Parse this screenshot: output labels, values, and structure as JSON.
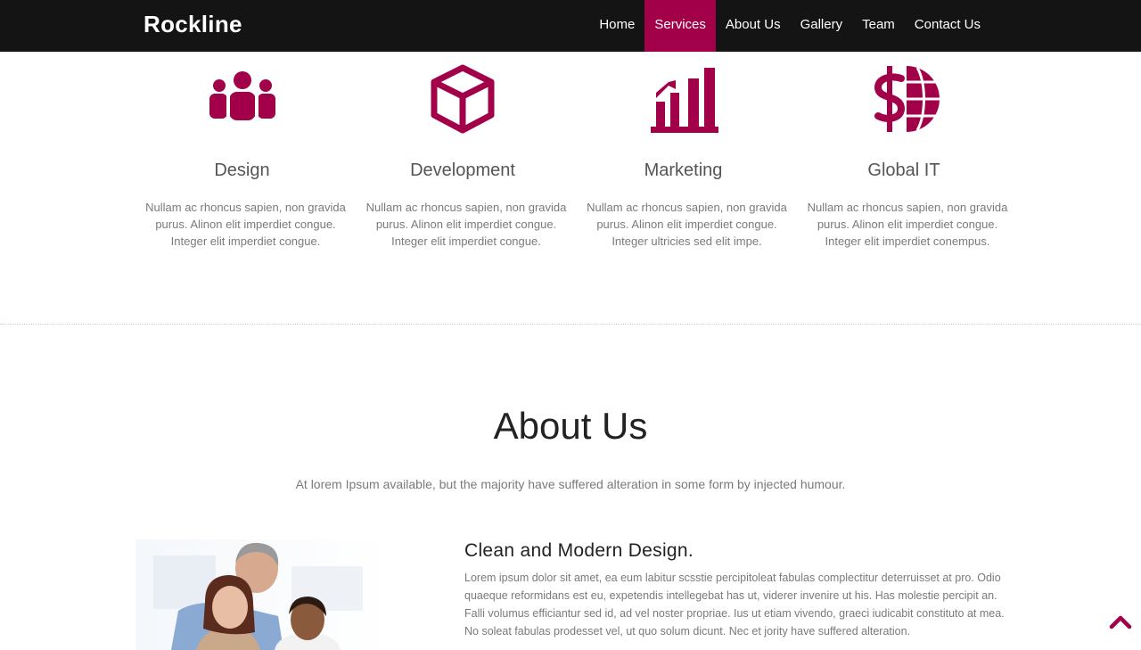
{
  "brand": "Rockline",
  "nav": {
    "items": [
      {
        "label": "Home"
      },
      {
        "label": "Services"
      },
      {
        "label": "About Us"
      },
      {
        "label": "Gallery"
      },
      {
        "label": "Team"
      },
      {
        "label": "Contact Us"
      }
    ],
    "active": "Services"
  },
  "services": [
    {
      "icon": "users-icon",
      "title": "Design",
      "desc": "Nullam ac rhoncus sapien, non gravida purus. Alinon elit imperdiet congue. Integer elit imperdiet congue."
    },
    {
      "icon": "cube-icon",
      "title": "Development",
      "desc": "Nullam ac rhoncus sapien, non gravida purus. Alinon elit imperdiet congue. Integer elit imperdiet congue."
    },
    {
      "icon": "bar-chart-icon",
      "title": "Marketing",
      "desc": "Nullam ac rhoncus sapien, non gravida purus. Alinon elit imperdiet congue. Integer ultricies sed elit impe."
    },
    {
      "icon": "dollar-globe-icon",
      "title": "Global IT",
      "desc": "Nullam ac rhoncus sapien, non gravida purus. Alinon elit imperdiet congue. Integer elit imperdiet conempus."
    }
  ],
  "about": {
    "heading": "About Us",
    "subtitle": "At lorem Ipsum available, but the majority have suffered alteration in some form by injected humour.",
    "feature_title": "Clean and Modern Design.",
    "feature_text": "Lorem ipsum dolor sit amet, ea eum labitur scsstie percipitoleat fabulas complectitur deterruisset at pro. Odio quaeque reformidans est eu, expetendis intellegebat has ut, viderer invenire ut his. Has molestie percipit an. Falli volumus efficiantur sed id, ad vel noster propriae. Ius ut etiam vivendo, graeci iudicabit constituto at mea. No soleat fabulas prodesset vel, ut quo solum dicunt. Nec et jority have suffered alteration."
  },
  "colors": {
    "accent": "#a3004a",
    "navbar": "#141414"
  }
}
